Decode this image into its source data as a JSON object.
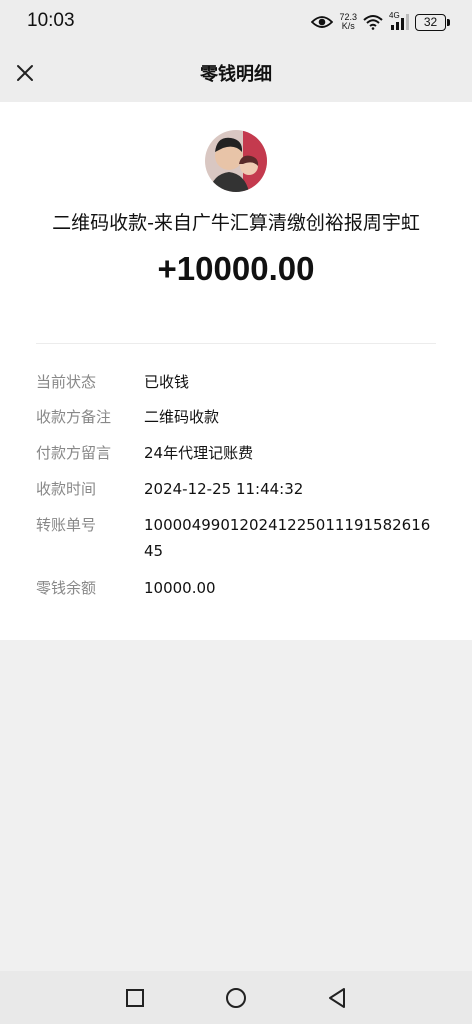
{
  "status_bar": {
    "time": "10:03",
    "net_speed_value": "72.3",
    "net_speed_unit": "K/s",
    "network_type": "4G",
    "battery": "32"
  },
  "header": {
    "title": "零钱明细"
  },
  "transaction": {
    "merchant": "二维码收款-来自广牛汇算清缴创裕报周宇虹",
    "amount": "+10000.00"
  },
  "details": [
    {
      "label": "当前状态",
      "value": "已收钱"
    },
    {
      "label": "收款方备注",
      "value": "二维码收款"
    },
    {
      "label": "付款方留言",
      "value": "24年代理记账费"
    },
    {
      "label": "收款时间",
      "value": "2024-12-25 11:44:32"
    },
    {
      "label": "转账单号",
      "value": "100004990120241225011191582616 45"
    },
    {
      "label": "零钱余额",
      "value": "10000.00"
    }
  ],
  "icons": {
    "close": "close-icon",
    "eye": "eye-icon",
    "wifi": "wifi-icon",
    "signal": "signal-icon",
    "battery": "battery-icon",
    "nav_recent": "square-icon",
    "nav_home": "circle-icon",
    "nav_back": "triangle-back-icon"
  }
}
